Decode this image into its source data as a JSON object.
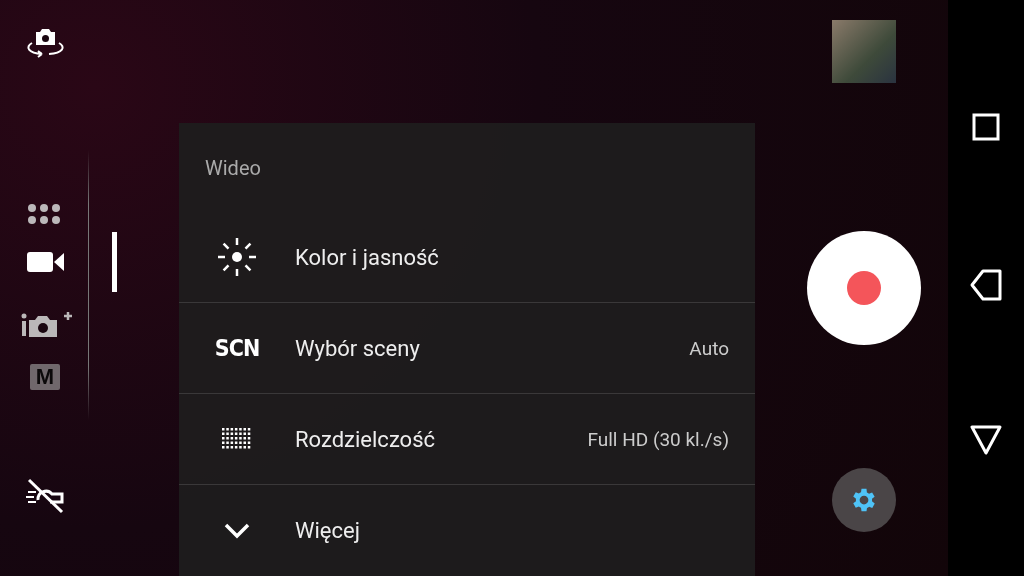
{
  "modes": [
    {
      "kind": "apps",
      "selected": false
    },
    {
      "kind": "video",
      "selected": true
    },
    {
      "kind": "ar",
      "selected": false
    },
    {
      "kind": "manual",
      "text": "M",
      "selected": false
    }
  ],
  "panel": {
    "title": "Wideo",
    "items": [
      {
        "kind": "brightness",
        "label": "Kolor i jasność"
      },
      {
        "kind": "text",
        "icon_text": "SCN",
        "label": "Wybór sceny",
        "value": "Auto"
      },
      {
        "kind": "resolution",
        "label": "Rozdzielczość",
        "value": "Full HD (30 kl./s)"
      },
      {
        "kind": "more",
        "label": "Więcej"
      }
    ]
  }
}
